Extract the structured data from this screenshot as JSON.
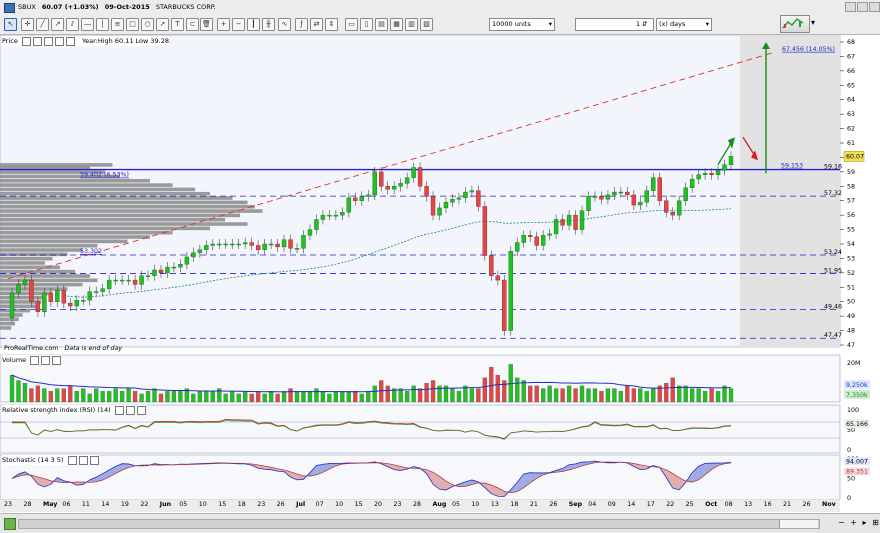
{
  "toolbar": {
    "symbol": "SBUX",
    "price_change": "60.07 (+1.03%)",
    "date": "09-Oct-2015",
    "name": "STARBUCKS CORP.",
    "units": "10000 units",
    "period_value": "1",
    "period_unit": "(x) days"
  },
  "price_panel": {
    "title": "Price",
    "year_stats": "Year:High 60.11 Low 39.28",
    "watermark": "ProRealTime.com",
    "eod_note": "Data is end of day",
    "current_price": "60.07",
    "target_label": "67.456 (14.05%)",
    "level_label_a": "59.153",
    "level_label_b": "59.402 (6.53%)",
    "level_label_c": "53.302",
    "y_ticks": [
      "68",
      "67",
      "66",
      "65",
      "64",
      "63",
      "62",
      "61",
      "60",
      "59",
      "58",
      "57",
      "56",
      "55",
      "54",
      "53",
      "52",
      "51",
      "50",
      "49",
      "48",
      "47"
    ],
    "hlines": [
      "59.16",
      "57.32",
      "53.24",
      "51.95",
      "49.46",
      "47.47"
    ]
  },
  "volume_panel": {
    "title": "Volume",
    "tick": "20M",
    "label_a": "9,250k",
    "label_b": "7,350k"
  },
  "rsi_panel": {
    "title": "Relative strength index (RSI) (14)",
    "ticks": [
      "100",
      "50",
      "0"
    ],
    "value": "65.166"
  },
  "stoch_panel": {
    "title": "Stochastic (14 3 5)",
    "ticks": [
      "100",
      "50",
      "0"
    ],
    "value_a": "94.007",
    "value_b": "89.351"
  },
  "date_axis": [
    {
      "t": "23",
      "b": false
    },
    {
      "t": "28",
      "b": false
    },
    {
      "t": "May",
      "b": true
    },
    {
      "t": "06",
      "b": false
    },
    {
      "t": "11",
      "b": false
    },
    {
      "t": "14",
      "b": false
    },
    {
      "t": "19",
      "b": false
    },
    {
      "t": "22",
      "b": false
    },
    {
      "t": "Jun",
      "b": true
    },
    {
      "t": "05",
      "b": false
    },
    {
      "t": "10",
      "b": false
    },
    {
      "t": "15",
      "b": false
    },
    {
      "t": "18",
      "b": false
    },
    {
      "t": "23",
      "b": false
    },
    {
      "t": "26",
      "b": false
    },
    {
      "t": "Jul",
      "b": true
    },
    {
      "t": "07",
      "b": false
    },
    {
      "t": "10",
      "b": false
    },
    {
      "t": "15",
      "b": false
    },
    {
      "t": "20",
      "b": false
    },
    {
      "t": "23",
      "b": false
    },
    {
      "t": "28",
      "b": false
    },
    {
      "t": "Aug",
      "b": true
    },
    {
      "t": "05",
      "b": false
    },
    {
      "t": "10",
      "b": false
    },
    {
      "t": "13",
      "b": false
    },
    {
      "t": "18",
      "b": false
    },
    {
      "t": "21",
      "b": false
    },
    {
      "t": "26",
      "b": false
    },
    {
      "t": "Sep",
      "b": true
    },
    {
      "t": "04",
      "b": false
    },
    {
      "t": "09",
      "b": false
    },
    {
      "t": "14",
      "b": false
    },
    {
      "t": "17",
      "b": false
    },
    {
      "t": "22",
      "b": false
    },
    {
      "t": "25",
      "b": false
    },
    {
      "t": "Oct",
      "b": true
    },
    {
      "t": "08",
      "b": false
    },
    {
      "t": "13",
      "b": false
    },
    {
      "t": "16",
      "b": false
    },
    {
      "t": "21",
      "b": false
    },
    {
      "t": "26",
      "b": false
    },
    {
      "t": "Nov",
      "b": true
    }
  ],
  "colors": {
    "up": "#22c022",
    "down": "#e04848",
    "level": "#2222cc",
    "trend": "#e03030",
    "ma": "#1a8a6a"
  }
}
